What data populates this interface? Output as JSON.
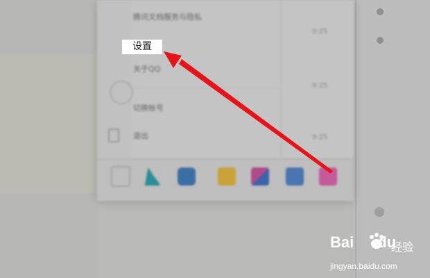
{
  "callout": {
    "label": "设置"
  },
  "menu": {
    "items": [
      {
        "label": "腾讯文档服务与隐私"
      },
      {
        "label": "关于QQ"
      },
      {
        "label": "切换帐号"
      },
      {
        "label": "退出"
      }
    ],
    "times": [
      "9:25",
      "9:25",
      "9:25"
    ]
  },
  "taskbar": {
    "icons": [
      {
        "name": "grid-icon",
        "color": "#9a9a9a"
      },
      {
        "name": "app-teal-icon",
        "color": "#2a8e96"
      },
      {
        "name": "app-blue-icon",
        "color": "#3b6ea5"
      },
      {
        "name": "app-yellow-icon",
        "color": "#c9a23a"
      },
      {
        "name": "app-pink-blue-icon",
        "color": "#b04a8a"
      },
      {
        "name": "app-blue-square-icon",
        "color": "#4a74b0"
      },
      {
        "name": "app-pink-icon",
        "color": "#c45a9a"
      }
    ]
  },
  "watermark": {
    "logo": "Bai",
    "logo_tail": "du",
    "cn": "经验",
    "url": "jingyan.baidu.com"
  },
  "colors": {
    "arrow": "#e5141a",
    "accent": "#ffffff"
  }
}
